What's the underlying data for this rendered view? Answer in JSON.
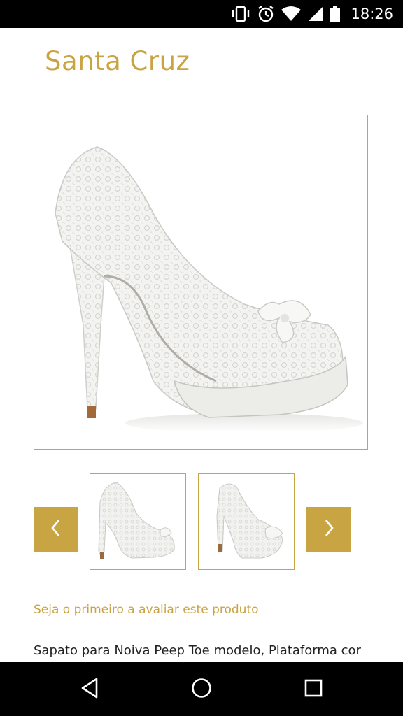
{
  "status_bar": {
    "time": "18:26",
    "icons": [
      "vibrate-icon",
      "alarm-icon",
      "wifi-icon",
      "signal-icon",
      "battery-icon"
    ]
  },
  "product": {
    "brand": "Santa Cruz",
    "main_image": "white-lace-peep-toe-platform-shoe",
    "thumbnails": [
      "shoe-side-view-thumbnail",
      "shoe-angle-view-thumbnail"
    ],
    "review_link": "Seja o primeiro a avaliar este produto",
    "description": "Sapato para Noiva Peep Toe modelo, Plataforma cor"
  },
  "carousel": {
    "prev_icon": "chevron-left-icon",
    "next_icon": "chevron-right-icon"
  },
  "nav_bar": {
    "icons": [
      "back-icon",
      "home-icon",
      "recents-icon"
    ]
  },
  "colors": {
    "accent": "#c9a443",
    "status_bar": "#000000",
    "nav_bar": "#000000",
    "text": "#222222",
    "background": "#ffffff"
  }
}
